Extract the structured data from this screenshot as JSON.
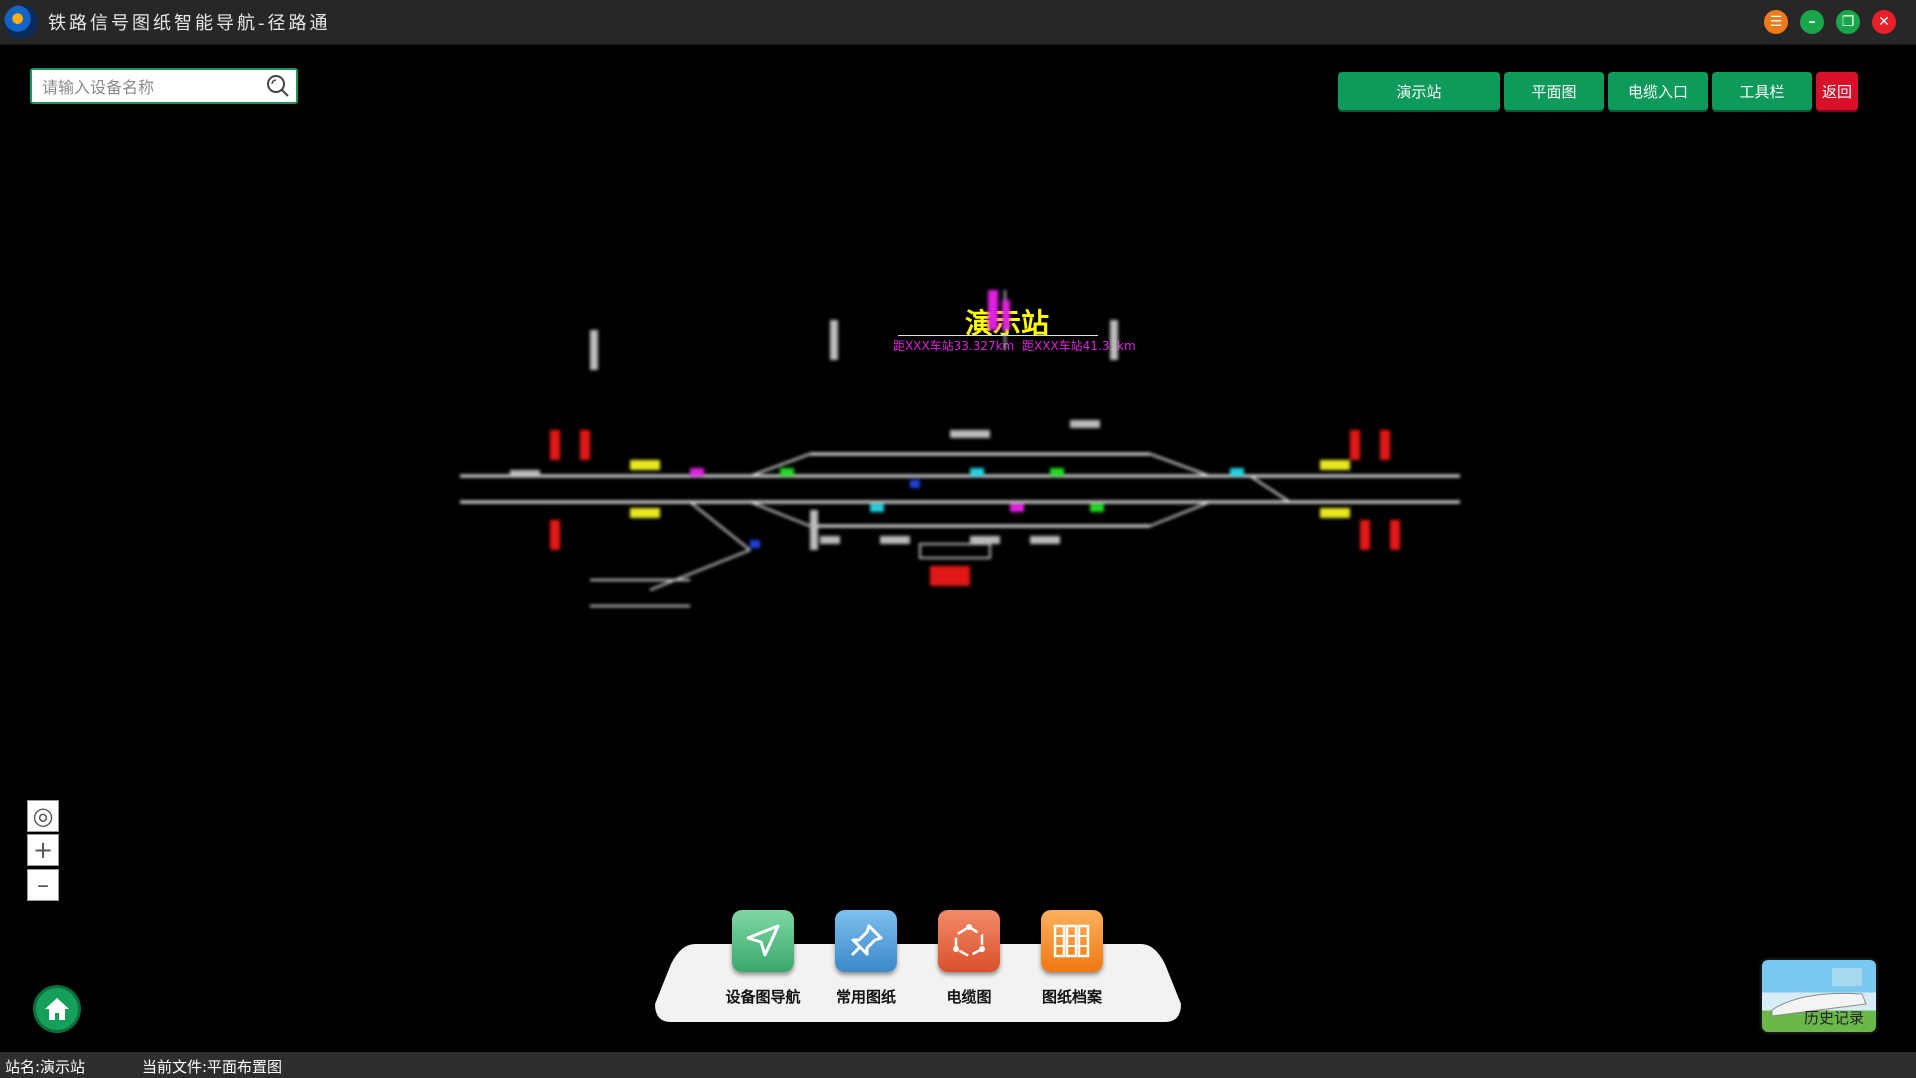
{
  "window": {
    "title": "铁路信号图纸智能导航-径路通",
    "buttons": {
      "menu": "☰",
      "minimize": "–",
      "maximize": "❐",
      "close": "✕"
    }
  },
  "search": {
    "placeholder": "请输入设备名称",
    "value": ""
  },
  "toolbar": {
    "station": "演示站",
    "plan": "平面图",
    "cable_entry": "电缆入口",
    "tools": "工具栏",
    "back": "返回"
  },
  "diagram": {
    "station_name": "演示站",
    "mileage_left": "距XXX车站33.327km",
    "mileage_right": "距XXX车站41.33km"
  },
  "map_controls": {
    "locate": "◎",
    "zoom_in": "+",
    "zoom_out": "–"
  },
  "dock": {
    "items": [
      {
        "label": "设备图导航",
        "icon": "navigation-arrow-icon"
      },
      {
        "label": "常用图纸",
        "icon": "pin-icon"
      },
      {
        "label": "电缆图",
        "icon": "network-icon"
      },
      {
        "label": "图纸档案",
        "icon": "archive-icon"
      }
    ]
  },
  "history": {
    "label": "历史记录"
  },
  "status": {
    "station": "站名:演示站",
    "file": "当前文件:平面布置图"
  },
  "colors": {
    "accent_green": "#0d9a5a",
    "danger_red": "#d8102a",
    "station_yellow": "#ffff00",
    "mileage_magenta": "#e020e0"
  }
}
